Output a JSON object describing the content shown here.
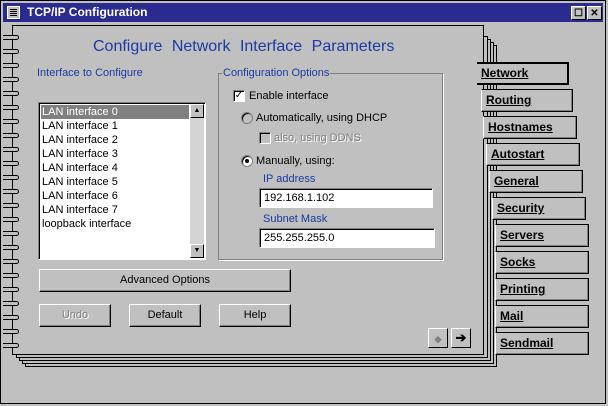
{
  "window": {
    "title": "TCP/IP Configuration",
    "close_glyph": "✕",
    "minimize_glyph": "☐",
    "title_icon": "notebook-icon"
  },
  "page": {
    "heading": "Configure Network Interface Parameters"
  },
  "interface_group": {
    "label": "Interface to Configure",
    "items": [
      "LAN interface 0",
      "LAN interface 1",
      "LAN interface 2",
      "LAN interface 3",
      "LAN interface 4",
      "LAN interface 5",
      "LAN interface 6",
      "LAN interface 7",
      "loopback interface"
    ],
    "selected_index": 0
  },
  "config_group": {
    "label": "Configuration Options",
    "enable_interface": {
      "label": "Enable interface",
      "checked": true
    },
    "dhcp": {
      "label": "Automatically, using DHCP",
      "selected": false
    },
    "also_ddns": {
      "label": "also, using DDNS",
      "checked": false,
      "disabled": true
    },
    "manual": {
      "label": "Manually, using:",
      "selected": true
    },
    "ip_address": {
      "label": "IP address",
      "value": "192.168.1.102"
    },
    "subnet_mask": {
      "label": "Subnet Mask",
      "value": "255.255.255.0"
    }
  },
  "buttons": {
    "advanced": "Advanced Options",
    "undo": "Undo",
    "default": "Default",
    "help": "Help",
    "prev_glyph": "◆",
    "next_glyph": "➔"
  },
  "tabs": [
    "Network",
    "Routing",
    "Hostnames",
    "Autostart",
    "General",
    "Security",
    "Servers",
    "Socks",
    "Printing",
    "Mail",
    "Sendmail"
  ],
  "active_tab": "Network",
  "check_glyph": "✓",
  "scroll_up_glyph": "▲",
  "scroll_down_glyph": "▼"
}
